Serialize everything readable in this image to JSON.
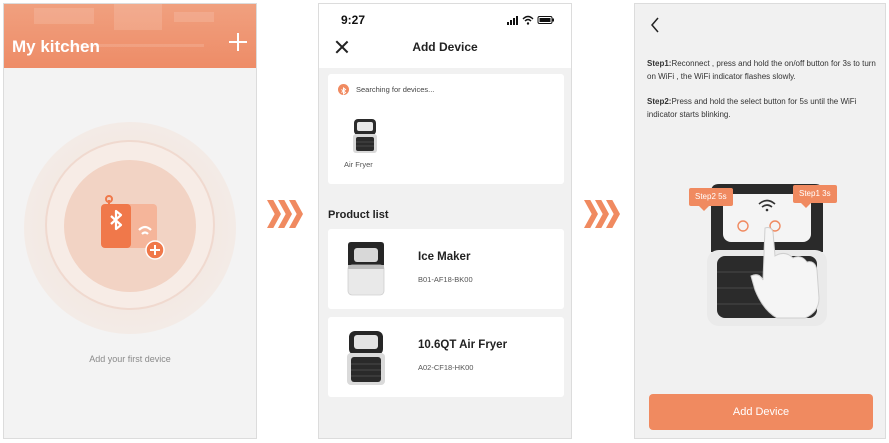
{
  "screen1": {
    "title": "My kitchen",
    "add_icon": "plus-icon",
    "device_icon": "bluetooth-device-icon",
    "empty_text": "Add your first device"
  },
  "screen2": {
    "status_time": "9:27",
    "title": "Add Device",
    "close_icon": "close-icon",
    "searching_text": "Searching for devices...",
    "found_device": {
      "label": "Air Fryer",
      "icon": "air-fryer-icon"
    },
    "product_list_title": "Product list",
    "products": [
      {
        "name": "Ice Maker",
        "model": "B01-AF18-BK00",
        "icon": "ice-maker-icon"
      },
      {
        "name": "10.6QT Air Fryer",
        "model": "A02-CF18-HK00",
        "icon": "air-fryer-icon"
      }
    ]
  },
  "screen3": {
    "back_icon": "chevron-left-icon",
    "step1_label": "Step1:",
    "step1_text": "Reconnect , press and hold the on/off button for 3s to turn on WiFi , the WiFi indicator flashes slowly.",
    "step2_label": "Step2:",
    "step2_text": "Press and hold the select button for 5s until the WiFi indicator starts blinking.",
    "tag_step2": "Step2   5s",
    "tag_step1": "Step1   3s",
    "add_button": "Add Device"
  },
  "colors": {
    "accent": "#f08a60",
    "header": "#ee8c67",
    "background": "#f1f1f1"
  }
}
